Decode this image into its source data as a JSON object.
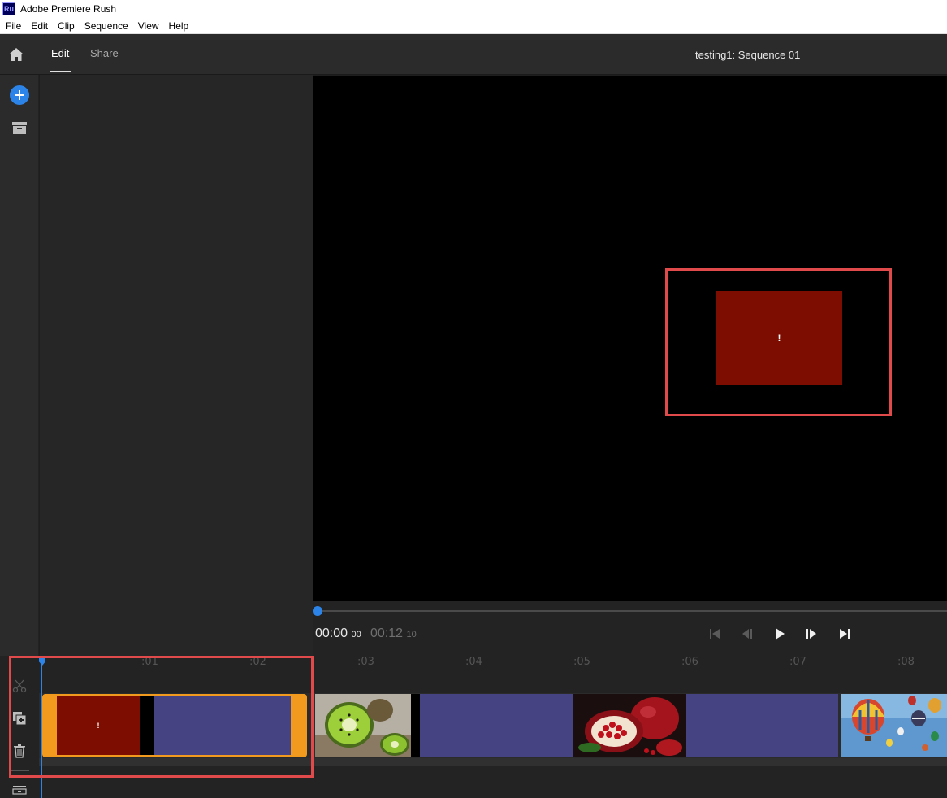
{
  "window": {
    "app_logo_text": "Ru",
    "title": "Adobe Premiere Rush"
  },
  "menu": [
    "File",
    "Edit",
    "Clip",
    "Sequence",
    "View",
    "Help"
  ],
  "header": {
    "tabs": [
      {
        "label": "Edit",
        "active": true
      },
      {
        "label": "Share",
        "active": false
      }
    ],
    "sequence_title": "testing1: Sequence 01"
  },
  "preview": {
    "clip_mark": "!"
  },
  "transport": {
    "current_time": "00:00",
    "current_frames": "00",
    "total_time": "00:12",
    "total_frames": "10",
    "playhead_fraction": 0.0
  },
  "timeline": {
    "ruler_ticks": [
      ":01",
      ":02",
      ":03",
      ":04",
      ":05",
      ":06",
      ":07",
      ":08"
    ],
    "clip1_mark": "!"
  },
  "colors": {
    "accent_blue": "#2c84e8",
    "highlight_red": "#e04a4a",
    "selected_clip_orange": "#f29a1e",
    "clip_placeholder_purple": "#454381",
    "missing_media_red": "#7d0d00"
  },
  "icons": {
    "home": "home-icon",
    "add": "plus-icon",
    "projects": "archive-icon",
    "split": "scissors-icon",
    "duplicate": "duplicate-icon",
    "delete": "trash-icon",
    "tracks": "track-options-icon",
    "go_start": "skip-to-start-icon",
    "step_back": "step-back-icon",
    "play": "play-icon",
    "step_forward": "step-forward-icon",
    "go_end": "skip-to-end-icon"
  }
}
